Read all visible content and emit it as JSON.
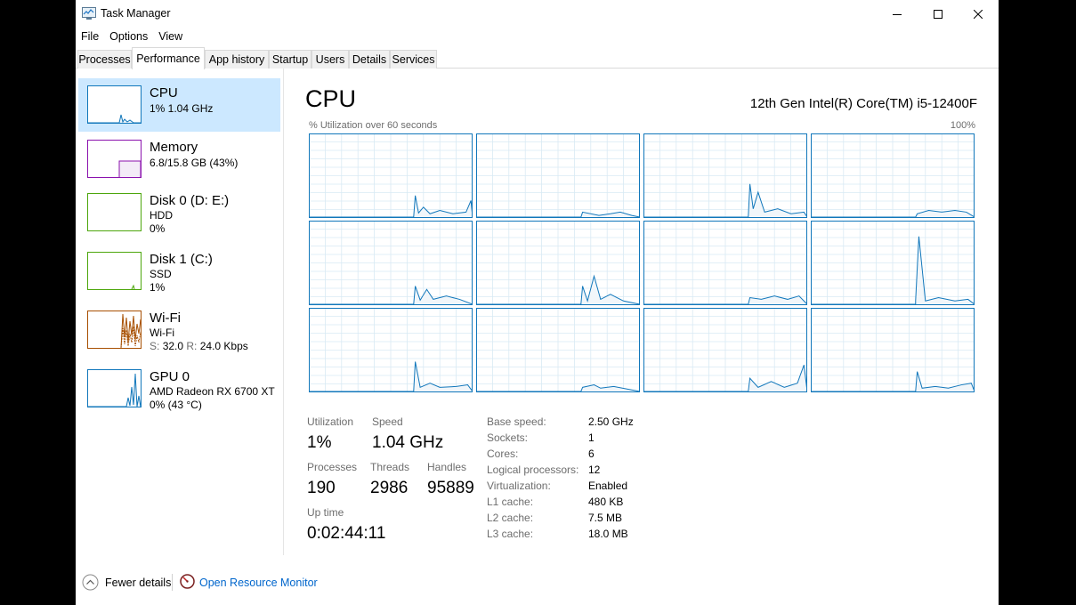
{
  "window": {
    "title": "Task Manager",
    "controls": [
      "minimize",
      "maximize",
      "close"
    ]
  },
  "menu": [
    "File",
    "Options",
    "View"
  ],
  "tabs": [
    {
      "label": "Processes",
      "active": false
    },
    {
      "label": "Performance",
      "active": true
    },
    {
      "label": "App history",
      "active": false
    },
    {
      "label": "Startup",
      "active": false
    },
    {
      "label": "Users",
      "active": false
    },
    {
      "label": "Details",
      "active": false
    },
    {
      "label": "Services",
      "active": false
    }
  ],
  "resources": [
    {
      "title": "CPU",
      "line1": "1% 1.04 GHz",
      "line2": "",
      "color": "#1177bb",
      "selected": true
    },
    {
      "title": "Memory",
      "line1": "6.8/15.8 GB (43%)",
      "line2": "",
      "color": "#8b12ae",
      "selected": false
    },
    {
      "title": "Disk 0 (D: E:)",
      "line1": "HDD",
      "line2": "0%",
      "color": "#4da60c",
      "selected": false
    },
    {
      "title": "Disk 1 (C:)",
      "line1": "SSD",
      "line2": "1%",
      "color": "#4da60c",
      "selected": false
    },
    {
      "title": "Wi-Fi",
      "line1": "Wi-Fi",
      "line2_parts": [
        "S:",
        "32.0",
        "R:",
        "24.0 Kbps"
      ],
      "color": "#a74f01",
      "selected": false
    },
    {
      "title": "GPU 0",
      "line1": "AMD Radeon RX 6700 XT",
      "line2": "0% (43 °C)",
      "color": "#1177bb",
      "selected": false
    }
  ],
  "cpu": {
    "title": "CPU",
    "model": "12th Gen Intel(R) Core(TM) i5-12400F",
    "graph_caption": "% Utilization over 60 seconds",
    "graph_max": "100%",
    "core_count_graphs": 12
  },
  "stats": {
    "utilization_label": "Utilization",
    "utilization": "1%",
    "speed_label": "Speed",
    "speed": "1.04 GHz",
    "processes_label": "Processes",
    "processes": "190",
    "threads_label": "Threads",
    "threads": "2986",
    "handles_label": "Handles",
    "handles": "95889",
    "uptime_label": "Up time",
    "uptime": "0:02:44:11"
  },
  "specs": [
    {
      "label": "Base speed:",
      "value": "2.50 GHz"
    },
    {
      "label": "Sockets:",
      "value": "1"
    },
    {
      "label": "Cores:",
      "value": "6"
    },
    {
      "label": "Logical processors:",
      "value": "12"
    },
    {
      "label": "Virtualization:",
      "value": "Enabled"
    },
    {
      "label": "L1 cache:",
      "value": "480 KB"
    },
    {
      "label": "L2 cache:",
      "value": "7.5 MB"
    },
    {
      "label": "L3 cache:",
      "value": "18.0 MB"
    }
  ],
  "footer": {
    "fewer_details": "Fewer details",
    "open_monitor": "Open Resource Monitor"
  },
  "colors": {
    "cpu_line": "#1177bb",
    "cpu_fill": "#f1f6fa",
    "grid": "#d9eaf4",
    "selection": "#cce8ff",
    "link": "#0066cc"
  }
}
